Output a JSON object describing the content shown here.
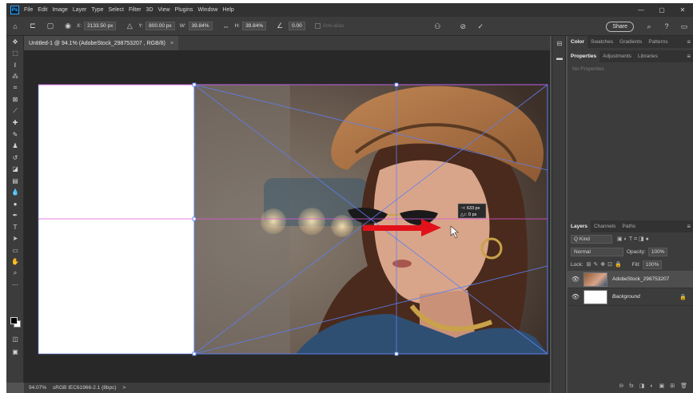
{
  "menubar": {
    "logo": "Ps",
    "items": [
      "File",
      "Edit",
      "Image",
      "Layer",
      "Type",
      "Select",
      "Filter",
      "3D",
      "View",
      "Plugins",
      "Window",
      "Help"
    ],
    "window_controls": [
      "—",
      "▢",
      "✕"
    ]
  },
  "options": {
    "x_label": "X:",
    "x_value": "2133.50 px",
    "y_label": "Y:",
    "y_value": "800.00 px",
    "w_label": "W:",
    "w_value": "39.84%",
    "h_label": "H:",
    "h_value": "39.84%",
    "angle_value": "0.00",
    "antialias_label": "Anti-alias",
    "share_label": "Share"
  },
  "document": {
    "tab_title": "Untitled-1 @ 94.1% (AdobeStock_298753207 , RGB/8)",
    "tab_close": "×"
  },
  "canvas": {
    "transform_readout": [
      "⊣: 633 px",
      "△↕:   0 px"
    ]
  },
  "status": {
    "zoom": "94.07%",
    "profile": "sRGB IEC61966-2.1 (8bpc)",
    "arrow": ">"
  },
  "panels": {
    "top_tabs": [
      "Color",
      "Swatches",
      "Gradients",
      "Patterns"
    ],
    "prop_tabs": [
      "Properties",
      "Adjustments",
      "Libraries"
    ],
    "no_properties": "No Properties",
    "layer_tabs": [
      "Layers",
      "Channels",
      "Paths"
    ],
    "kind_placeholder": "Q Kind",
    "blend_mode": "Normal",
    "opacity_label": "Opacity:",
    "opacity_value": "100%",
    "lock_label": "Lock:",
    "fill_label": "Fill:",
    "fill_value": "100%",
    "layers": [
      {
        "name": "AdobeStock_298753207"
      },
      {
        "name": "Background"
      }
    ],
    "bottom_icons": [
      "⊖",
      "fx",
      "◨",
      "◐",
      "▣",
      "⊞",
      "🗑"
    ]
  },
  "colors": {
    "guide": "#e055e0",
    "transform_line": "#5d7ff0",
    "arrow": "#e3121a",
    "accent": "#31a8ff"
  }
}
